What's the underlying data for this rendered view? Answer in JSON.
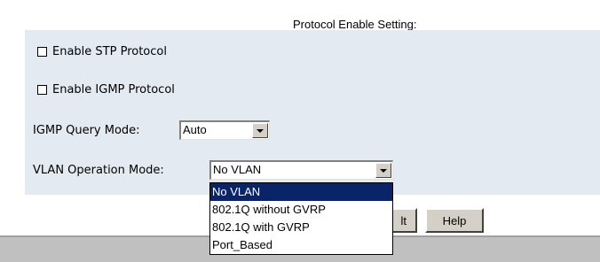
{
  "page": {
    "title": "Protocol Enable Setting:"
  },
  "stp": {
    "label": "Enable STP Protocol",
    "checked": false
  },
  "igmp": {
    "label": "Enable IGMP Protocol",
    "checked": false
  },
  "igmp_query_mode": {
    "label": "IGMP Query Mode:",
    "value": "Auto"
  },
  "vlan_mode": {
    "label": "VLAN Operation Mode:",
    "value": "No VLAN",
    "options": [
      "No VLAN",
      "802.1Q without GVRP",
      "802.1Q with GVRP",
      "Port_Based"
    ],
    "highlighted": "No VLAN"
  },
  "buttons": {
    "partial_label": "lt",
    "help_label": "Help"
  },
  "colors": {
    "panel_bg": "#e4eaf2",
    "highlight": "#0a246a",
    "footer_bar": "#c0c0c0"
  }
}
